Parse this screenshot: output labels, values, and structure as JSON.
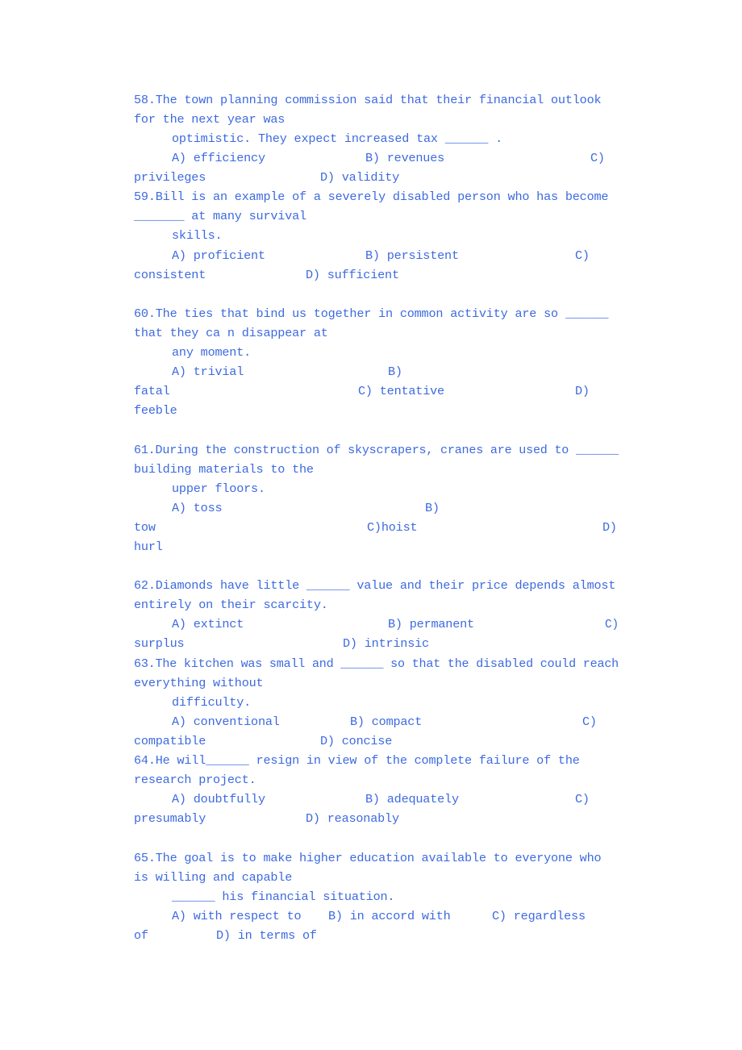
{
  "document": {
    "text_color": "#3d6ae0",
    "questions": [
      {
        "number": "58",
        "lines": [
          "58.The town planning commission said that their financial outlook",
          "for the next year was",
          "optimistic. They expect increased tax ______ ."
        ],
        "options_line1": [
          "A) efficiency",
          "B) revenues",
          "C)"
        ],
        "options_line2": [
          "privileges",
          "D) validity"
        ]
      },
      {
        "number": "59",
        "lines": [
          "59.Bill is an example of a severely disabled person who has become",
          "_______ at many survival",
          "skills."
        ],
        "options_line1": [
          "A) proficient",
          "B) persistent",
          "C)"
        ],
        "options_line2": [
          "consistent",
          "D) sufficient"
        ]
      },
      {
        "number": "60",
        "lines": [
          "60.The ties that bind us together in common activity are so ______",
          "that they ca n disappear at",
          "any moment."
        ],
        "options_line1": [
          "A) trivial",
          "B)"
        ],
        "options_line2": [
          "fatal",
          "C) tentative",
          "D)"
        ],
        "options_line3": [
          "feeble"
        ]
      },
      {
        "number": "61",
        "lines": [
          "61.During the construction of skyscrapers, cranes are used to ______",
          "building materials to the",
          "upper floors."
        ],
        "options_line1": [
          "A) toss",
          "B)"
        ],
        "options_line2": [
          "tow",
          "C)hoist",
          "D)"
        ],
        "options_line3": [
          "hurl"
        ]
      },
      {
        "number": "62",
        "lines": [
          "62.Diamonds have little ______ value and their price depends almost",
          "entirely on their scarcity."
        ],
        "options_line1": [
          "A) extinct",
          "B) permanent",
          "C)"
        ],
        "options_line2": [
          "surplus",
          "D) intrinsic"
        ]
      },
      {
        "number": "63",
        "lines": [
          "63.The kitchen was small and ______ so that the disabled could reach",
          "everything without",
          "difficulty."
        ],
        "options_line1": [
          "A) conventional",
          "B) compact",
          "C)"
        ],
        "options_line2": [
          "compatible",
          "D) concise"
        ]
      },
      {
        "number": "64",
        "lines": [
          "64.He will______ resign in view of the complete failure of the",
          "research project."
        ],
        "options_line1": [
          "A) doubtfully",
          "B) adequately",
          "C)"
        ],
        "options_line2": [
          "presumably",
          "D) reasonably"
        ]
      },
      {
        "number": "65",
        "lines": [
          "65.The goal is to make higher education available to everyone who",
          "is willing and capable",
          "______ his financial situation."
        ],
        "options_line1": [
          "A) with respect to",
          "B) in accord with",
          "C) regardless"
        ],
        "options_line2": [
          "of",
          "D) in terms of"
        ]
      }
    ]
  }
}
